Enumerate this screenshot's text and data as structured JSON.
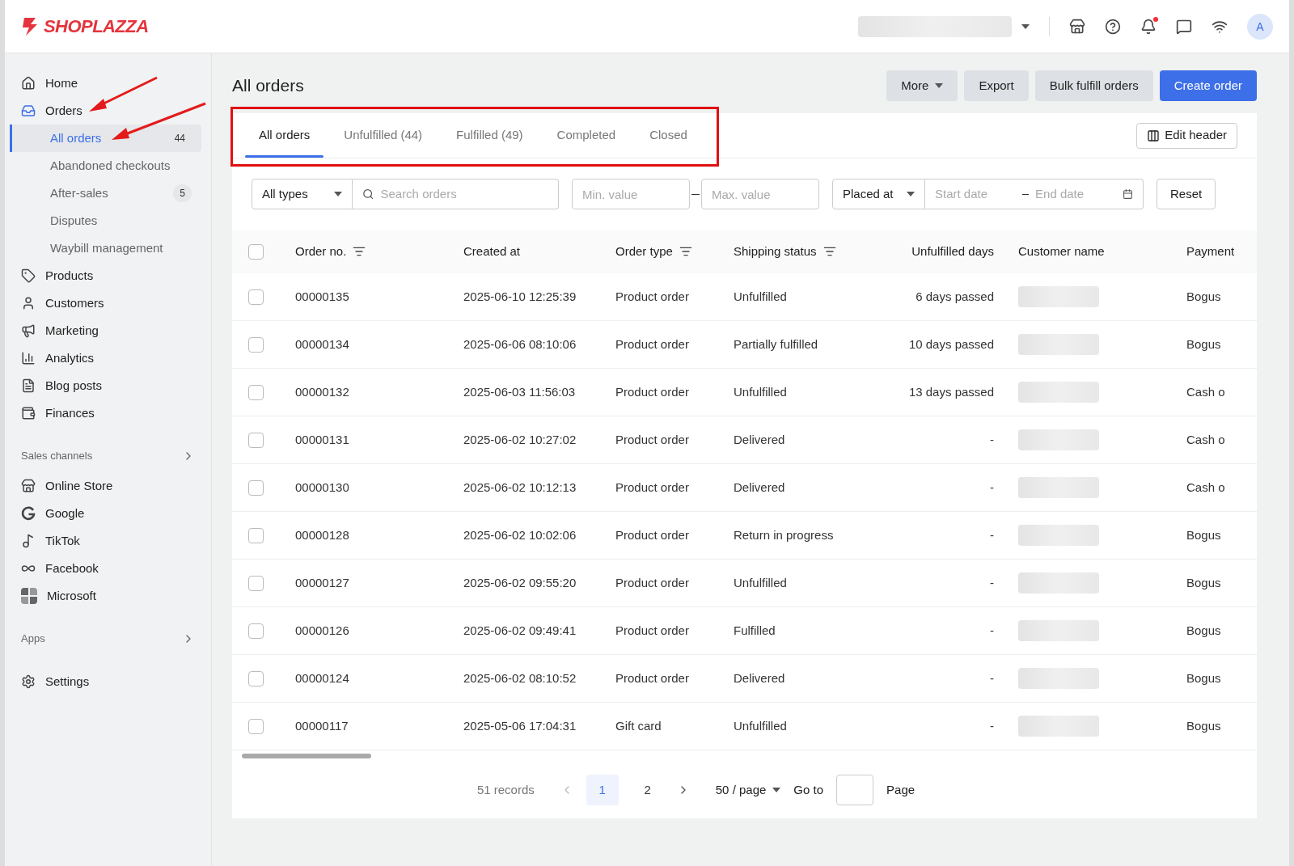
{
  "topbar": {
    "logo": "SHOPLAZZA",
    "notification_dot": true,
    "avatar": "A"
  },
  "sidebar": {
    "main": [
      {
        "label": "Home",
        "selected": false
      },
      {
        "label": "Orders",
        "selected": true,
        "children": [
          {
            "label": "All orders",
            "selected": true,
            "badge": "44"
          },
          {
            "label": "Abandoned checkouts",
            "selected": false
          },
          {
            "label": "After-sales",
            "selected": false,
            "badge": "5"
          },
          {
            "label": "Disputes",
            "selected": false
          },
          {
            "label": "Waybill management",
            "selected": false
          }
        ]
      },
      {
        "label": "Products",
        "selected": false
      },
      {
        "label": "Customers",
        "selected": false
      },
      {
        "label": "Marketing",
        "selected": false
      },
      {
        "label": "Analytics",
        "selected": false
      },
      {
        "label": "Blog posts",
        "selected": false
      },
      {
        "label": "Finances",
        "selected": false
      }
    ],
    "sales_channels": {
      "title": "Sales channels",
      "items": [
        {
          "label": "Online Store"
        },
        {
          "label": "Google"
        },
        {
          "label": "TikTok"
        },
        {
          "label": "Facebook"
        },
        {
          "label": "Microsoft"
        }
      ]
    },
    "apps": {
      "title": "Apps"
    },
    "settings": {
      "label": "Settings"
    }
  },
  "page": {
    "title": "All orders",
    "buttons": [
      {
        "label": "More",
        "kind": "dropdown"
      },
      {
        "label": "Export",
        "kind": "secondary"
      },
      {
        "label": "Bulk fulfill orders",
        "kind": "secondary"
      },
      {
        "label": "Create order",
        "kind": "primary"
      }
    ]
  },
  "tabs": [
    {
      "label": "All orders",
      "selected": true
    },
    {
      "label": "Unfulfilled (44)",
      "selected": false
    },
    {
      "label": "Fulfilled (49)",
      "selected": false
    },
    {
      "label": "Completed",
      "selected": false
    },
    {
      "label": "Closed",
      "selected": false
    }
  ],
  "edit_header": "Edit header",
  "filters": {
    "type": "All types",
    "search": {
      "placeholder": "Search orders"
    },
    "min": {
      "placeholder": "Min. value"
    },
    "max": {
      "placeholder": "Max. value"
    },
    "date_field": "Placed at",
    "start": {
      "placeholder": "Start date"
    },
    "end": {
      "placeholder": "End date"
    },
    "reset": "Reset"
  },
  "table": {
    "header_checked": false,
    "columns": [
      {
        "label": "Order no.",
        "filter": true
      },
      {
        "label": "Created at",
        "filter": false
      },
      {
        "label": "Order type",
        "filter": true
      },
      {
        "label": "Shipping status",
        "filter": true
      },
      {
        "label": "Unfulfilled days",
        "filter": false
      },
      {
        "label": "Customer name",
        "filter": false
      },
      {
        "label": "Payment",
        "filter": false
      }
    ],
    "rows": [
      {
        "checked": false,
        "cells": [
          "00000135",
          "2025-06-10 12:25:39",
          "Product order",
          "Unfulfilled",
          "6 days passed",
          "Bogus"
        ]
      },
      {
        "checked": false,
        "cells": [
          "00000134",
          "2025-06-06 08:10:06",
          "Product order",
          "Partially fulfilled",
          "10 days passed",
          "Bogus"
        ]
      },
      {
        "checked": false,
        "cells": [
          "00000132",
          "2025-06-03 11:56:03",
          "Product order",
          "Unfulfilled",
          "13 days passed",
          "Cash o"
        ]
      },
      {
        "checked": false,
        "cells": [
          "00000131",
          "2025-06-02 10:27:02",
          "Product order",
          "Delivered",
          "-",
          "Cash o"
        ]
      },
      {
        "checked": false,
        "cells": [
          "00000130",
          "2025-06-02 10:12:13",
          "Product order",
          "Delivered",
          "-",
          "Cash o"
        ]
      },
      {
        "checked": false,
        "cells": [
          "00000128",
          "2025-06-02 10:02:06",
          "Product order",
          "Return in progress",
          "-",
          "Bogus"
        ]
      },
      {
        "checked": false,
        "cells": [
          "00000127",
          "2025-06-02 09:55:20",
          "Product order",
          "Unfulfilled",
          "-",
          "Bogus"
        ]
      },
      {
        "checked": false,
        "cells": [
          "00000126",
          "2025-06-02 09:49:41",
          "Product order",
          "Fulfilled",
          "-",
          "Bogus"
        ]
      },
      {
        "checked": false,
        "cells": [
          "00000124",
          "2025-06-02 08:10:52",
          "Product order",
          "Delivered",
          "-",
          "Bogus"
        ]
      },
      {
        "checked": false,
        "cells": [
          "00000117",
          "2025-05-06 17:04:31",
          "Gift card",
          "Unfulfilled",
          "-",
          "Bogus"
        ]
      }
    ]
  },
  "pagination": {
    "records": "51 records",
    "pages": [
      {
        "label": "1",
        "selected": true
      },
      {
        "label": "2",
        "selected": false
      }
    ],
    "page_size": "50 / page",
    "goto": "Go to",
    "page_label": "Page"
  }
}
